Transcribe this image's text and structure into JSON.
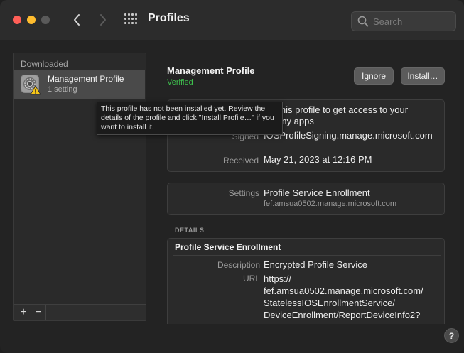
{
  "window": {
    "title": "Profiles",
    "search_placeholder": "Search"
  },
  "sidebar": {
    "section_header": "Downloaded",
    "items": [
      {
        "name": "Management Profile",
        "subtitle": "1 setting",
        "icon": "gear-warning-icon"
      }
    ],
    "add_label": "+",
    "remove_label": "−"
  },
  "profile": {
    "name": "Management Profile",
    "status": "Verified",
    "ignore_label": "Ignore",
    "install_label": "Install…",
    "description_visible": "tall this profile to get access to your mpany apps",
    "signed_label": "Signed",
    "signed_value": "IOSProfileSigning.manage.microsoft.com",
    "received_label": "Received",
    "received_value": "May 21, 2023 at 12:16 PM",
    "settings_label": "Settings",
    "settings_value": "Profile Service Enrollment",
    "settings_sub": "fef.amsua0502.manage.microsoft.com"
  },
  "details": {
    "header": "DETAILS",
    "title": "Profile Service Enrollment",
    "description_label": "Description",
    "description_value": "Encrypted Profile Service",
    "url_label": "URL",
    "url_value": "https:// fef.amsua0502.manage.microsoft.com/ StatelessIOSEnrollmentService/ DeviceEnrollment/ReportDeviceInfo2?"
  },
  "tooltip": {
    "text": "This profile has not been installed yet. Review the details of the profile and click \"Install Profile…\" if you want to install it."
  },
  "help_label": "?",
  "colors": {
    "verified": "#3ec14e",
    "close": "#ff5f57",
    "minimize": "#febc2e"
  }
}
